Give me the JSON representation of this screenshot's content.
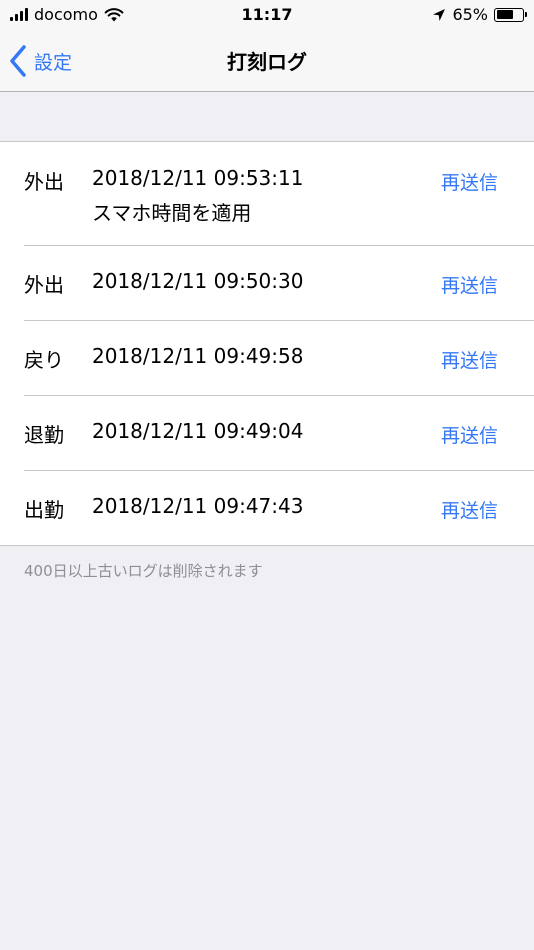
{
  "status_bar": {
    "carrier": "docomo",
    "time": "11:17",
    "battery_percent": "65%",
    "battery_level": 0.65,
    "icons": [
      "signal-bars",
      "wifi-icon",
      "location-arrow-icon",
      "battery-icon"
    ]
  },
  "nav": {
    "back_label": "設定",
    "title": "打刻ログ"
  },
  "logs": [
    {
      "type": "外出",
      "time": "2018/12/11 09:53:11",
      "note": "スマホ時間を適用",
      "action": "再送信"
    },
    {
      "type": "外出",
      "time": "2018/12/11 09:50:30",
      "note": "",
      "action": "再送信"
    },
    {
      "type": "戻り",
      "time": "2018/12/11 09:49:58",
      "note": "",
      "action": "再送信"
    },
    {
      "type": "退勤",
      "time": "2018/12/11 09:49:04",
      "note": "",
      "action": "再送信"
    },
    {
      "type": "出勤",
      "time": "2018/12/11 09:47:43",
      "note": "",
      "action": "再送信"
    }
  ],
  "footer_note": "400日以上古いログは削除されます",
  "colors": {
    "accent": "#3478f6",
    "background": "#efeff4",
    "separator": "#c8c7cc",
    "secondary_text": "#8e8e93"
  }
}
